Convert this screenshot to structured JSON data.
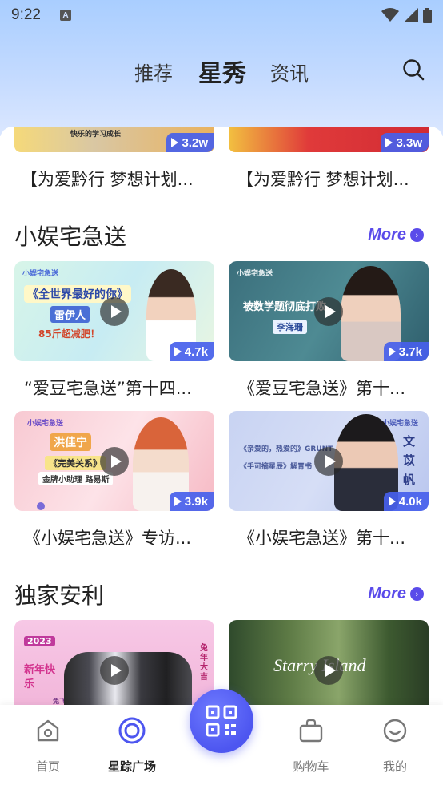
{
  "status_bar": {
    "time": "9:22",
    "notification_badge": "A"
  },
  "tabs": {
    "items": [
      "推荐",
      "星秀",
      "资讯"
    ],
    "active": "星秀"
  },
  "prev_row": {
    "items": [
      {
        "title": "【为爱黔行 梦想计划...",
        "views": "3.2w",
        "caption": "快乐的学习成长"
      },
      {
        "title": "【为爱黔行 梦想计划...",
        "views": "3.3w"
      }
    ]
  },
  "sections": [
    {
      "title": "小娱宅急送",
      "more_label": "More",
      "cards": [
        {
          "title": "“爱豆宅急送”第十四...",
          "views": "4.7k",
          "overlay": {
            "brand": "小娱宅急送",
            "line1": "《全世界最好的你》",
            "name": "雷伊人",
            "line3": "85斤超减肥！"
          }
        },
        {
          "title": "《爱豆宅急送》第十...",
          "views": "3.7k",
          "overlay": {
            "brand": "小娱宅急送",
            "line1": "被数学题彻底打败",
            "name": "李海珊"
          }
        },
        {
          "title": "《小娱宅急送》专访...",
          "views": "3.9k",
          "overlay": {
            "brand": "小娱宅急送",
            "name": "洪佳宁",
            "line2": "《完美关系》",
            "line3": "金牌小助理 路易斯"
          }
        },
        {
          "title": "《小娱宅急送》第十...",
          "views": "4.0k",
          "overlay": {
            "brand": "小娱宅急送",
            "line1": "《亲爱的，热爱的》GRUNT",
            "line2": "《手可摘星辰》解青书",
            "name": "文苡帆"
          }
        }
      ]
    },
    {
      "title": "独家安利",
      "more_label": "More",
      "cards": [
        {
          "title": "",
          "views": "",
          "overlay": {
            "year": "2023",
            "line1": "新年快乐",
            "tag": "兔年大吉",
            "side": "兔飞猛进"
          }
        },
        {
          "title": "",
          "views": "",
          "overlay": {
            "line1": "Starry Island"
          }
        }
      ]
    }
  ],
  "bottom_nav": {
    "items": [
      {
        "label": "首页",
        "icon": "home-icon"
      },
      {
        "label": "星踪广场",
        "icon": "star-circle-icon",
        "active": true
      },
      {
        "label": "",
        "icon": "qr-code-icon"
      },
      {
        "label": "购物车",
        "icon": "cart-icon"
      },
      {
        "label": "我的",
        "icon": "profile-icon"
      }
    ]
  },
  "colors": {
    "accent": "#5a4bea",
    "badge": "#465feb",
    "center_button": "#4d56f0"
  }
}
